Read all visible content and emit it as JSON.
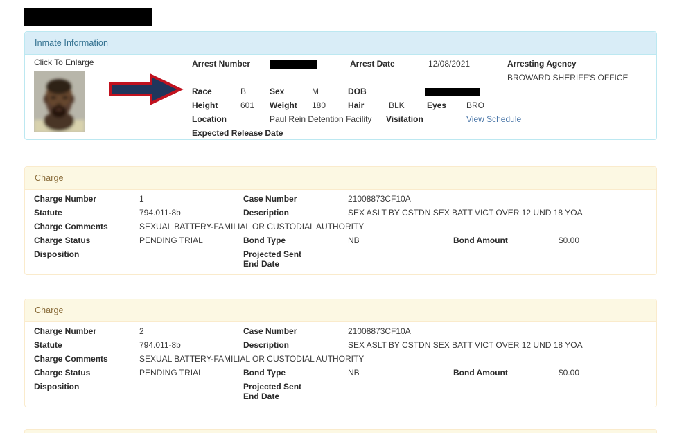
{
  "page": {
    "title_redacted": true,
    "colors": {
      "info_panel_bg": "#d9edf7",
      "info_panel_border": "#bce8f1",
      "info_panel_text": "#31708f",
      "charge_panel_bg": "#fcf8e3",
      "charge_panel_border": "#faebcc",
      "charge_panel_text": "#8a6d3b",
      "link": "#4a76a8",
      "arrow_fill": "#20365c",
      "arrow_outline": "#c1121f",
      "redaction": "#000000"
    }
  },
  "inmate_panel": {
    "header": "Inmate Information",
    "enlarge_label": "Click To Enlarge",
    "photo_alt": "inmate-mugshot",
    "fields": {
      "arrest_number_label": "Arrest Number",
      "arrest_number_value": "",
      "arrest_date_label": "Arrest Date",
      "arrest_date_value": "12/08/2021",
      "arresting_agency_label": "Arresting Agency",
      "arresting_agency_value": "BROWARD SHERIFF'S OFFICE",
      "race_label": "Race",
      "race_value": "B",
      "sex_label": "Sex",
      "sex_value": "M",
      "dob_label": "DOB",
      "dob_value": "",
      "height_label": "Height",
      "height_value": "601",
      "weight_label": "Weight",
      "weight_value": "180",
      "hair_label": "Hair",
      "hair_value": "BLK",
      "eyes_label": "Eyes",
      "eyes_value": "BRO",
      "location_label": "Location",
      "location_value": "Paul Rein Detention Facility",
      "visitation_label": "Visitation",
      "visitation_link": "View Schedule",
      "expected_release_label": "Expected Release Date",
      "expected_release_value": ""
    }
  },
  "charges": [
    {
      "header": "Charge",
      "charge_number_label": "Charge Number",
      "charge_number_value": "1",
      "case_number_label": "Case Number",
      "case_number_value": "21008873CF10A",
      "statute_label": "Statute",
      "statute_value": "794.011-8b",
      "description_label": "Description",
      "description_value": "SEX ASLT BY CSTDN SEX BATT VICT OVER 12 UND 18 YOA",
      "charge_comments_label": "Charge Comments",
      "charge_comments_value": "SEXUAL BATTERY-FAMILIAL OR CUSTODIAL AUTHORITY",
      "charge_status_label": "Charge Status",
      "charge_status_value": "PENDING TRIAL",
      "bond_type_label": "Bond Type",
      "bond_type_value": "NB",
      "bond_amount_label": "Bond Amount",
      "bond_amount_value": "$0.00",
      "disposition_label": "Disposition",
      "disposition_value": "",
      "projected_sent_end_label": "Projected Sent End Date",
      "projected_sent_end_value": ""
    },
    {
      "header": "Charge",
      "charge_number_label": "Charge Number",
      "charge_number_value": "2",
      "case_number_label": "Case Number",
      "case_number_value": "21008873CF10A",
      "statute_label": "Statute",
      "statute_value": "794.011-8b",
      "description_label": "Description",
      "description_value": "SEX ASLT BY CSTDN SEX BATT VICT OVER 12 UND 18 YOA",
      "charge_comments_label": "Charge Comments",
      "charge_comments_value": "SEXUAL BATTERY-FAMILIAL OR CUSTODIAL AUTHORITY",
      "charge_status_label": "Charge Status",
      "charge_status_value": "PENDING TRIAL",
      "bond_type_label": "Bond Type",
      "bond_type_value": "NB",
      "bond_amount_label": "Bond Amount",
      "bond_amount_value": "$0.00",
      "disposition_label": "Disposition",
      "disposition_value": "",
      "projected_sent_end_label": "Projected Sent End Date",
      "projected_sent_end_value": ""
    }
  ]
}
